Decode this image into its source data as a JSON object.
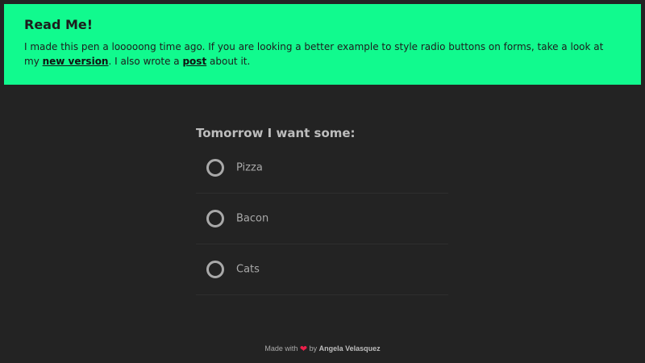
{
  "notice": {
    "title": "Read Me!",
    "text_before": "I made this pen a looooong time ago. If you are looking a better example to style radio buttons on forms, take a look at my ",
    "link1": "new version",
    "text_middle": ". I also wrote a ",
    "link2": "post",
    "text_after": " about it.",
    "background": "#11fa8e"
  },
  "form": {
    "title": "Tomorrow I want some:",
    "options": [
      {
        "label": "Pizza"
      },
      {
        "label": "Bacon"
      },
      {
        "label": "Cats"
      }
    ]
  },
  "footer": {
    "made_with": "Made with",
    "heart": "❤",
    "by": "by",
    "author": "Angela Velasquez"
  },
  "colors": {
    "page_background": "#232323",
    "accent": "#11fa8e",
    "heart": "#ec1f4a"
  }
}
